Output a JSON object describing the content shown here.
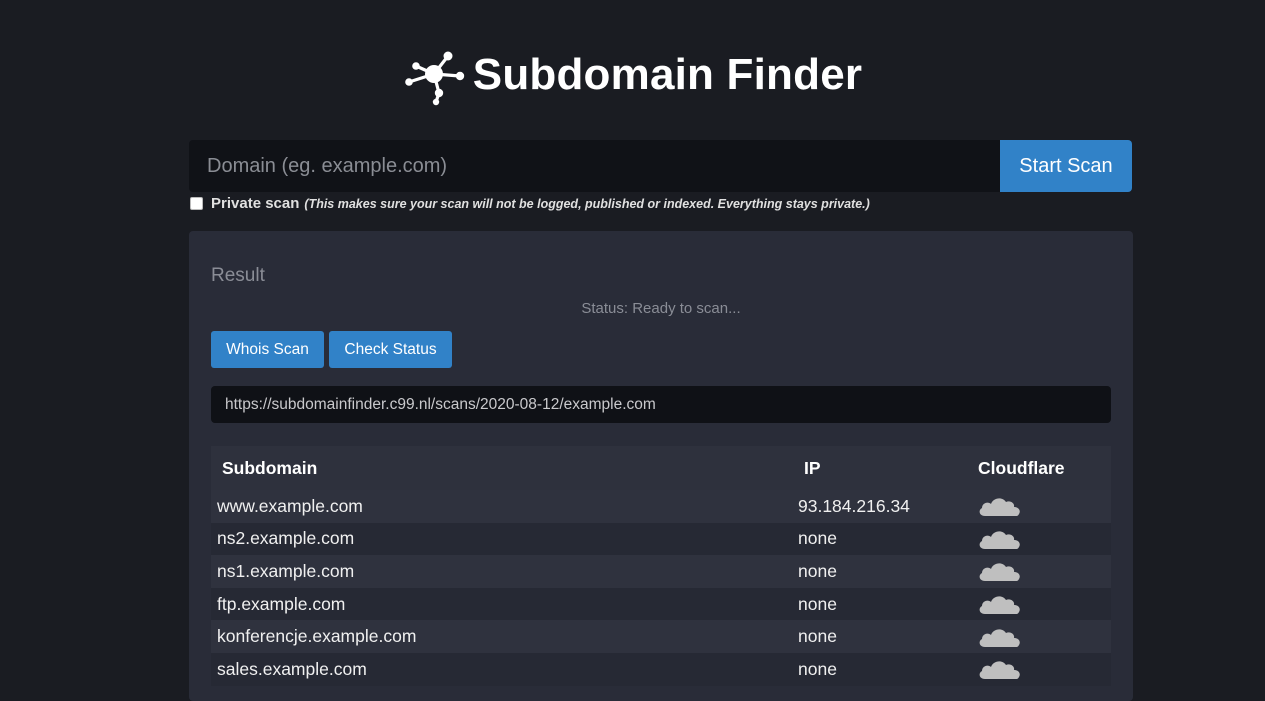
{
  "app": {
    "title": "Subdomain Finder"
  },
  "search": {
    "placeholder": "Domain (eg. example.com)",
    "value": "",
    "button_label": "Start Scan"
  },
  "private_scan": {
    "label": "Private scan",
    "note": "(This makes sure your scan will not be logged, published or indexed. Everything stays private.)",
    "checked": false
  },
  "result": {
    "title": "Result",
    "status": "Status: Ready to scan...",
    "whois_label": "Whois Scan",
    "check_label": "Check Status",
    "scan_url": "https://subdomainfinder.c99.nl/scans/2020-08-12/example.com"
  },
  "table": {
    "headers": {
      "subdomain": "Subdomain",
      "ip": "IP",
      "cloudflare": "Cloudflare"
    },
    "rows": [
      {
        "subdomain": "www.example.com",
        "ip": "93.184.216.34",
        "cloudflare": "cloud-icon"
      },
      {
        "subdomain": "ns2.example.com",
        "ip": "none",
        "cloudflare": "cloud-icon"
      },
      {
        "subdomain": "ns1.example.com",
        "ip": "none",
        "cloudflare": "cloud-icon"
      },
      {
        "subdomain": "ftp.example.com",
        "ip": "none",
        "cloudflare": "cloud-icon"
      },
      {
        "subdomain": "konferencje.example.com",
        "ip": "none",
        "cloudflare": "cloud-icon"
      },
      {
        "subdomain": "sales.example.com",
        "ip": "none",
        "cloudflare": "cloud-icon"
      }
    ]
  },
  "colors": {
    "background": "#1a1c22",
    "panel": "#292c38",
    "accent": "#3182c8",
    "cloud_inactive": "#bfbfbf"
  }
}
